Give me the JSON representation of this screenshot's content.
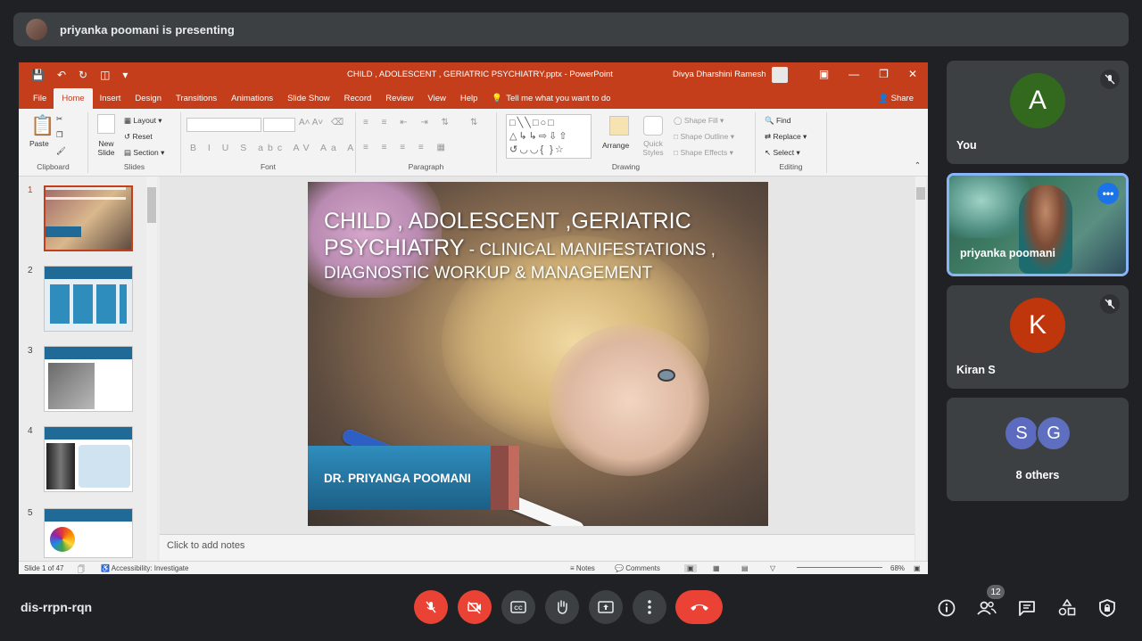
{
  "banner": {
    "text": "priyanka poomani is presenting"
  },
  "powerpoint": {
    "file_title": "CHILD , ADOLESCENT , GERIATRIC PSYCHIATRY.pptx  -  PowerPoint",
    "user_name": "Divya Dharshini Ramesh",
    "menu": [
      "File",
      "Home",
      "Insert",
      "Design",
      "Transitions",
      "Animations",
      "Slide Show",
      "Record",
      "Review",
      "View",
      "Help"
    ],
    "tell_me": "Tell me what you want to do",
    "share": "Share",
    "ribbon": {
      "paste": "Paste",
      "clipboard": "Clipboard",
      "new_slide": "New Slide",
      "layout": "Layout",
      "reset": "Reset",
      "section": "Section",
      "slides": "Slides",
      "font": "Font",
      "paragraph": "Paragraph",
      "arrange": "Arrange",
      "quick_styles": "Quick Styles",
      "shape_fill": "Shape Fill",
      "shape_outline": "Shape Outline",
      "shape_effects": "Shape Effects",
      "drawing": "Drawing",
      "find": "Find",
      "replace": "Replace",
      "select": "Select",
      "editing": "Editing"
    },
    "thumbnails": [
      "1",
      "2",
      "3",
      "4",
      "5"
    ],
    "slide": {
      "title_line1": "CHILD , ADOLESCENT ,GERIATRIC",
      "title_line2_big": "PSYCHIATRY",
      "title_line2_small": " - CLINICAL MANIFESTATIONS ,",
      "title_line3": "DIAGNOSTIC WORKUP & MANAGEMENT",
      "author": "DR. PRIYANGA POOMANI"
    },
    "notes_placeholder": "Click to add notes",
    "status": {
      "slide_count": "Slide 1 of 47",
      "accessibility": "Accessibility: Investigate",
      "notes": "Notes",
      "comments": "Comments",
      "zoom": "68%"
    }
  },
  "participants": [
    {
      "initial": "A",
      "name": "You",
      "color": "#33691e"
    },
    {
      "name": "priyanka poomani"
    },
    {
      "initial": "K",
      "name": "Kiran S",
      "color": "#bf360c"
    },
    {
      "initials": [
        "S",
        "G"
      ],
      "name": "8 others"
    }
  ],
  "meeting": {
    "code": "dis-rrpn-rqn",
    "participant_count": "12"
  }
}
